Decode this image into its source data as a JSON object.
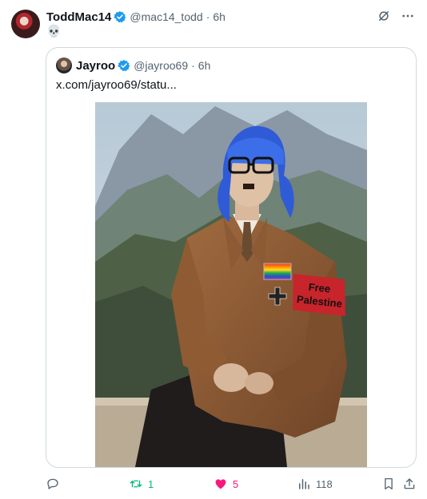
{
  "tweet": {
    "author_name": "ToddMac14",
    "handle": "@mac14_todd",
    "separator": "·",
    "time": "6h",
    "text": "💀"
  },
  "quote": {
    "author_name": "Jayroo",
    "handle": "@jayroo69",
    "separator": "·",
    "time": "6h",
    "link_text": "x.com/jayroo69/statu...",
    "armband_text_line1": "Free",
    "armband_text_line2": "Palestine"
  },
  "actions": {
    "reposts": "1",
    "likes": "5",
    "views": "118"
  },
  "colors": {
    "verified_blue": "#1d9bf0",
    "repost_green": "#00ba7c",
    "like_pink": "#f91880",
    "muted_gray": "#536471"
  }
}
